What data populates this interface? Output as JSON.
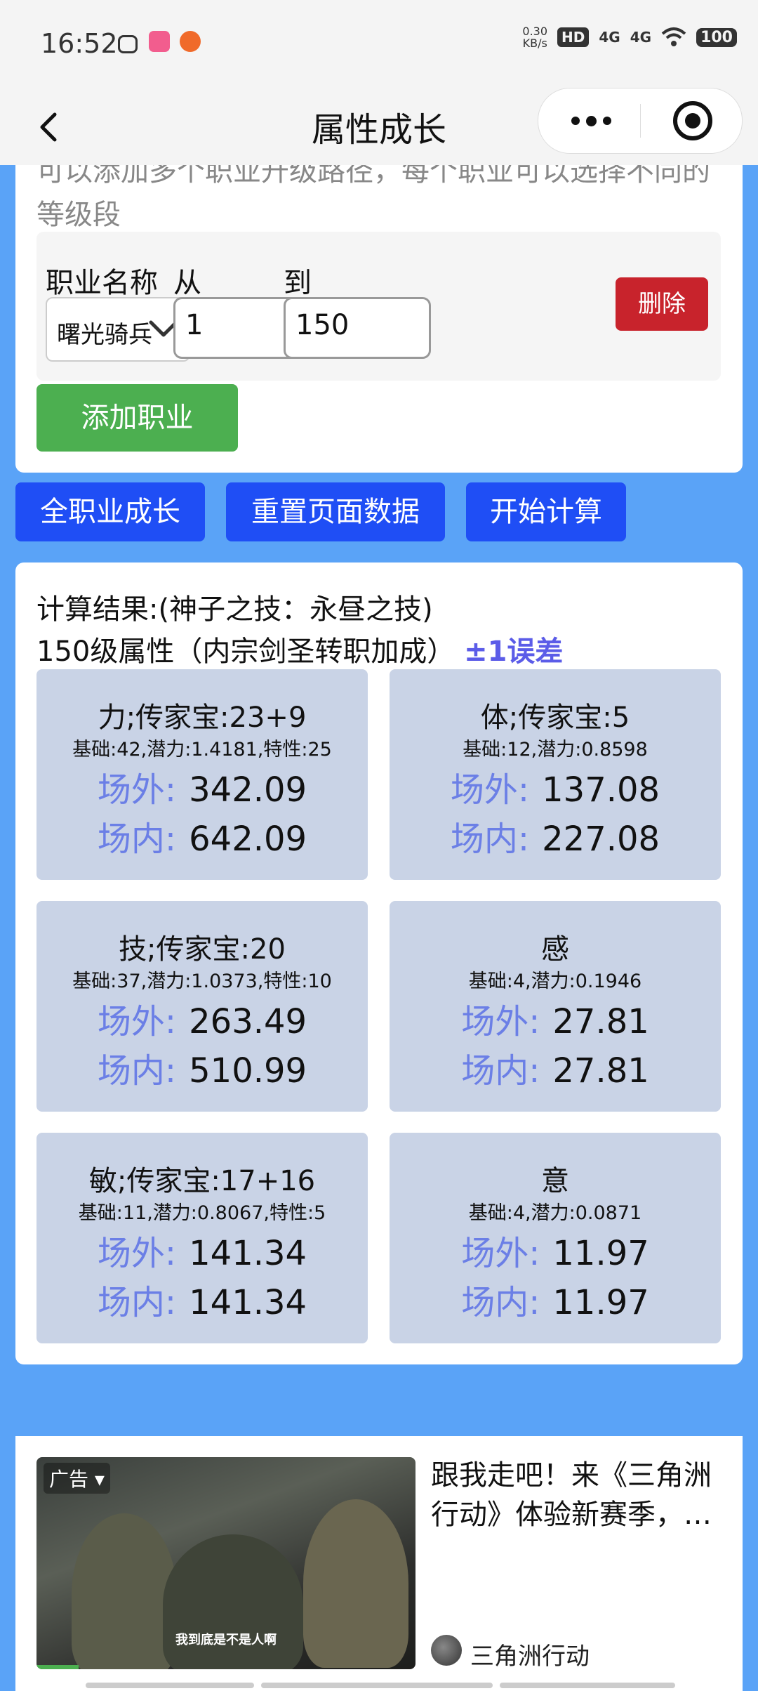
{
  "status_bar": {
    "time": "16:52",
    "net_speed_value": "0.30",
    "net_speed_unit": "KB/s",
    "hd_label": "HD",
    "sig1": "4G",
    "sig2": "4G",
    "battery": "100"
  },
  "nav": {
    "title": "属性成长"
  },
  "career_form": {
    "description": "可以添加多个职业升级路径，每个职业可以选择不同的等级段",
    "name_label": "职业名称",
    "from_label": "从",
    "to_label": "到",
    "selected_career": "曙光骑兵",
    "from_value": "1",
    "to_value": "150",
    "delete_label": "删除",
    "add_label": "添加职业"
  },
  "actions": {
    "all_growth": "全职业成长",
    "reset": "重置页面数据",
    "calculate": "开始计算"
  },
  "results": {
    "title": "计算结果:(神子之技：永昼之技)",
    "subtitle": "150级属性（内宗剑圣转职加成）",
    "error_note": "±1误差",
    "outside_label": "场外:",
    "inside_label": "场内:",
    "stats": [
      {
        "name": "力;传家宝:23+9",
        "base": "基础:42,潜力:1.4181,特性:25",
        "outside": "342.09",
        "inside": "642.09"
      },
      {
        "name": "体;传家宝:5",
        "base": "基础:12,潜力:0.8598",
        "outside": "137.08",
        "inside": "227.08"
      },
      {
        "name": "技;传家宝:20",
        "base": "基础:37,潜力:1.0373,特性:10",
        "outside": "263.49",
        "inside": "510.99"
      },
      {
        "name": "感",
        "base": "基础:4,潜力:0.1946",
        "outside": "27.81",
        "inside": "27.81"
      },
      {
        "name": "敏;传家宝:17+16",
        "base": "基础:11,潜力:0.8067,特性:5",
        "outside": "141.34",
        "inside": "141.34"
      },
      {
        "name": "意",
        "base": "基础:4,潜力:0.0871",
        "outside": "11.97",
        "inside": "11.97"
      }
    ]
  },
  "ad": {
    "tag": "广告",
    "caption": "我到底是不是人啊",
    "title": "跟我走吧！来《三角洲行动》体验新赛季，…",
    "advertiser": "三角洲行动"
  },
  "colors": {
    "page_bg": "#5aa3f7",
    "action_button": "#1f4ef5",
    "add_button": "#4caf50",
    "delete_button": "#c8232c",
    "stat_card": "#c9d3e6",
    "stat_key": "#6b7fe6"
  }
}
